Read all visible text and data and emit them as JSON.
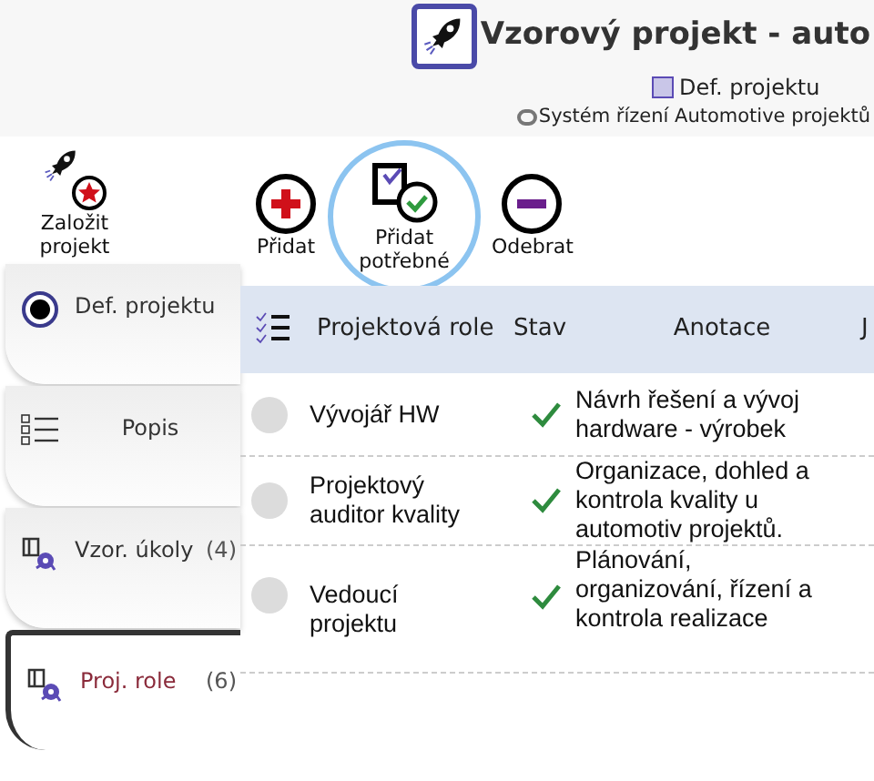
{
  "header": {
    "title": "Vzorový projekt - auto",
    "breadcrumb": "Def. projektu",
    "subtitle": "Systém řízení Automotive projektů"
  },
  "create_button": {
    "label": "Založit projekt"
  },
  "tabs": [
    {
      "label": "Def. projektu",
      "selected": false
    },
    {
      "label": "Popis",
      "selected": false
    },
    {
      "label": "Vzor. úkoly",
      "count": "(4)",
      "selected": false
    },
    {
      "label": "Proj. role",
      "count": "(6)",
      "selected": true
    }
  ],
  "toolbar": [
    {
      "label": "Přidat",
      "focused": false
    },
    {
      "label": "Přidat potřebné",
      "focused": true
    },
    {
      "label": "Odebrat",
      "focused": false
    }
  ],
  "table": {
    "columns": [
      "Projektová role",
      "Stav",
      "Anotace",
      "J"
    ],
    "rows": [
      {
        "selected": false,
        "role": "Vývojář HW",
        "done": true,
        "annotation": "Návrh řešení a vývoj hardware - výrobek"
      },
      {
        "selected": false,
        "role": "Projektový auditor kvality",
        "done": true,
        "annotation": "Organizace, dohled a kontrola kvality u automotiv projektů."
      },
      {
        "selected": false,
        "role": "Vedoucí projektu",
        "done": true,
        "annotation": "Plánování, organizování, řízení a kontrola realizace"
      }
    ]
  }
}
